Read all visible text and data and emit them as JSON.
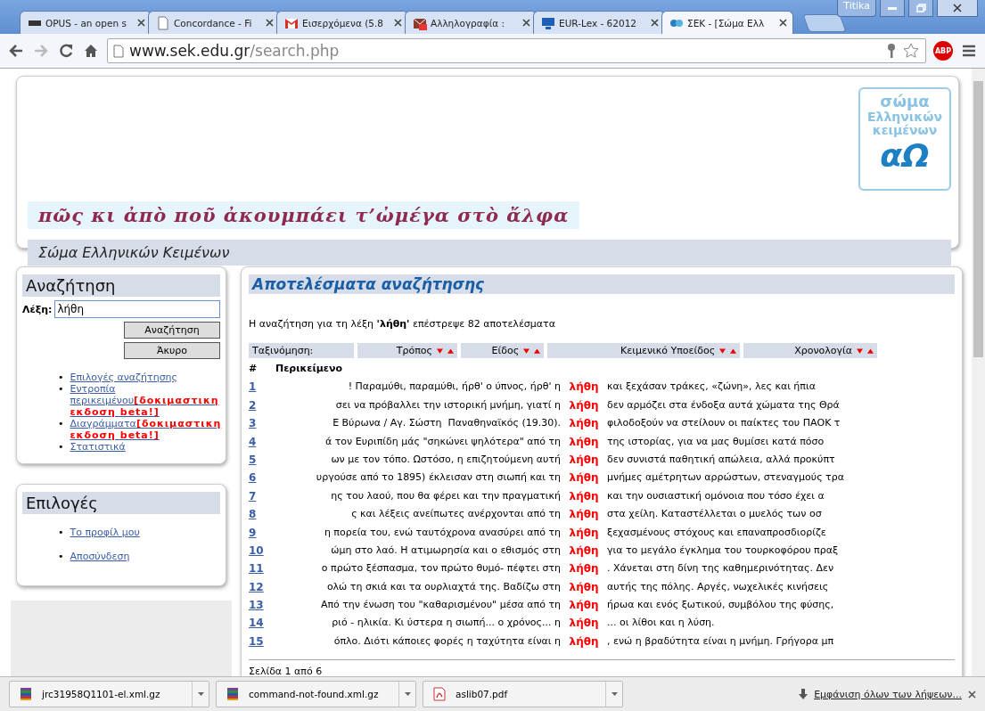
{
  "browser": {
    "tabs": [
      {
        "title": "OPUS - an open s",
        "kind": "opus",
        "selected": false
      },
      {
        "title": "Concordance - Fi",
        "kind": "doc",
        "selected": false
      },
      {
        "title": "Εισερχόμενα (5.8",
        "kind": "gmail",
        "selected": false
      },
      {
        "title": "Αλληλογραφία :",
        "kind": "mail",
        "selected": false
      },
      {
        "title": "EUR-Lex - 62012",
        "kind": "monitor",
        "selected": false
      },
      {
        "title": "ΣΕΚ - [Σώμα Ελλ",
        "kind": "sek",
        "selected": true
      }
    ],
    "profile": "Titika",
    "url_host": "www.sek.edu.gr",
    "url_path": "/search.php",
    "extension": "ABP"
  },
  "header": {
    "logo_lines": [
      "σώμα",
      "Ελληνικών",
      "κειμένων"
    ],
    "logo_mark": "αΩ",
    "motto": "πῶς κι ἀπὸ ποῦ ἀκουμπάει τ’ὠμέγα στὸ ἄλφα",
    "subtitle": "Σώμα Ελληνικών Κειμένων"
  },
  "search_panel": {
    "bullet": "•",
    "title": "Αναζήτηση",
    "field_label": "Λέξη:",
    "field_value": "λήθη",
    "buttons": [
      "Αναζήτηση",
      "Άκυρο"
    ],
    "links": [
      {
        "label": "Επιλογές αναζήτησης"
      },
      {
        "label": "Εντροπία περικειμένου",
        "badge": "[δοκιμαστικη εκδοση beta!]"
      },
      {
        "label": "Διαγράμματα",
        "badge": "[δοκιμαστικη εκδοση beta!]"
      },
      {
        "label": "Στατιστικά"
      }
    ]
  },
  "options_panel": {
    "bullet": "•",
    "title": "Επιλογές",
    "links": [
      "Το προφίλ μου",
      "Αποσύνδεση"
    ]
  },
  "results": {
    "title": "Αποτελέσματα αναζήτησης",
    "summary": "Η αναζήτηση για τη λέξη **'λήθη'** επέστρεψε 82 αποτελέσματα",
    "sort_label": "Ταξινόμηση:",
    "sort_columns": [
      "Τρόπος",
      "Είδος",
      "Κειμενικό Υποείδος",
      "Χρονολογία"
    ],
    "col_number": "#",
    "col_context": "Περικείμενο",
    "rows": [
      {
        "n": "1",
        "left": "! Παραμύθι, παραμύθι, ήρθ' ο ύπνος, ήρθ' η",
        "keyword": "λήθη",
        "right": "και ξεχάσαν τράκες, «ζώνη», λες και ήπια"
      },
      {
        "n": "2",
        "left": "σει να πρόβαλλει την ιστορική μνήμη, γιατί η",
        "keyword": "λήθη",
        "right": "δεν αρμόζει στα ένδοξα αυτά χώματα της Θρά"
      },
      {
        "n": "3",
        "left": "Ε Βύρωνα / Αγ. Σώστη  Παναθηναϊκός (19.30).",
        "keyword": "λήθη",
        "right": "φιλοδοξούν να στείλουν οι παίκτες του ΠΑΟΚ τ"
      },
      {
        "n": "4",
        "left": "ά τον Ευριπίδη μάς \"σηκώνει ψηλότερα\" από τη",
        "keyword": "λήθη",
        "right": "της ιστορίας, για να μας θυμίσει κατά πόσο"
      },
      {
        "n": "5",
        "left": "ων με τον τόπο. Ωστόσο, η επιζητούμενη αυτή",
        "keyword": "λήθη",
        "right": "δεν συνιστά παθητική απώλεια, αλλά προκύπτ"
      },
      {
        "n": "6",
        "left": "υργούσε από το 1895) έκλεισαν στη σιωπή και τη",
        "keyword": "λήθη",
        "right": "μνήμες αμέτρητων αρρώστων, στεναγμούς τρα"
      },
      {
        "n": "7",
        "left": "ης του λαού, που θα φέρει και την πραγματική",
        "keyword": "λήθη",
        "right": "και την ουσιαστική ομόνοια που τόσο έχει α"
      },
      {
        "n": "8",
        "left": "ς και λέξεις ανείπωτες ανέρχονται από τη",
        "keyword": "λήθη",
        "right": "στα χείλη. Καταστέλλεται ο μυελός των οσ"
      },
      {
        "n": "9",
        "left": "η πορεία του, ενώ ταυτόχρονα ανασύρει από τη",
        "keyword": "λήθη",
        "right": "ξεχασμένους στόχους και επαναπροσδιορίζε"
      },
      {
        "n": "10",
        "left": "ώμη στο λαό. Η ατιμωρησία και ο εθισμός στη",
        "keyword": "λήθη",
        "right": "για το μεγάλο έγκλημα του τουρκοφόρου πραξ"
      },
      {
        "n": "11",
        "left": "ο πρώτο ξέσπασμα, τον πρώτο θυμό- πέφτει στη",
        "keyword": "λήθη",
        "right": ". Χάνεται στη δίνη της καθημερινότητας. Δεν"
      },
      {
        "n": "12",
        "left": "ολώ τη σκιά και τα ουρλιαχτά της. Βαδίζω στη",
        "keyword": "λήθη",
        "right": "αυτής της πόλης. Αργές, νωχελικές κινήσεις"
      },
      {
        "n": "13",
        "left": "Από την ένωση του \"καθαρισμένου\" μέσα από τη",
        "keyword": "λήθη",
        "right": "ήρωα και ενός ξωτικού, συμβόλου της φύσης,"
      },
      {
        "n": "14",
        "left": "ριό - ηλικία. Κι ύστερα η σιωπή... ο χρόνος... η",
        "keyword": "λήθη",
        "right": "... οι λίθοι και η λύση."
      },
      {
        "n": "15",
        "left": "όπλο. Διότι κάποιες φορές η ταχύτητα είναι η",
        "keyword": "λήθη",
        "right": ", ενώ η βραδύτητα είναι η μνήμη. Γρήγορα μπ"
      }
    ],
    "pager": "Σελίδα 1 από 6"
  },
  "downloads": {
    "items": [
      {
        "name": "jrc31958Q1101-el.xml.gz",
        "kind": "archive"
      },
      {
        "name": "command-not-found.xml.gz",
        "kind": "archive"
      },
      {
        "name": "aslib07.pdf",
        "kind": "pdf"
      }
    ],
    "show_all": "Εμφάνιση όλων των λήψεων..."
  }
}
